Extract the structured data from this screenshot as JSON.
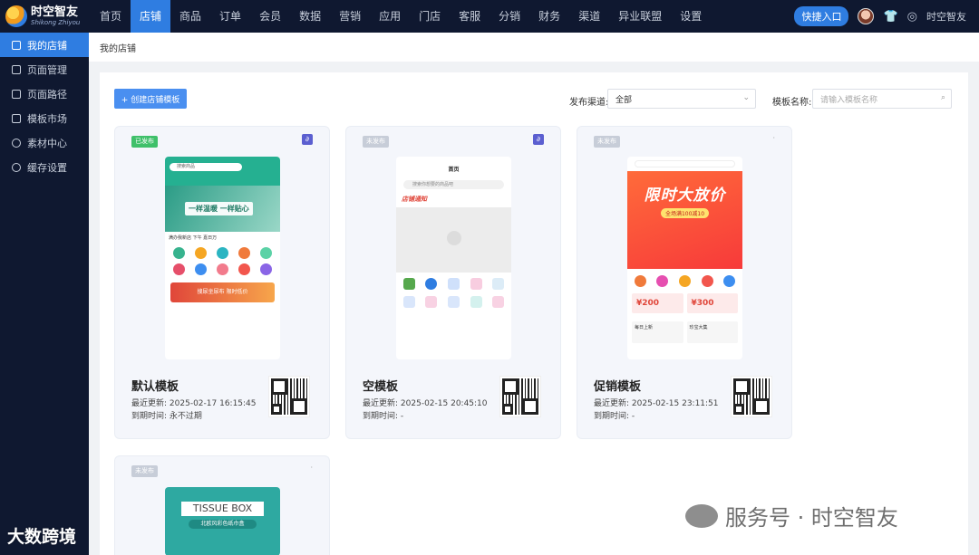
{
  "app": {
    "logo_cn": "时空智友",
    "logo_en": "Shikong Zhiyou"
  },
  "nav": [
    {
      "label": "首页"
    },
    {
      "label": "店铺",
      "active": true
    },
    {
      "label": "商品"
    },
    {
      "label": "订单"
    },
    {
      "label": "会员"
    },
    {
      "label": "数据"
    },
    {
      "label": "营销"
    },
    {
      "label": "应用"
    },
    {
      "label": "门店"
    },
    {
      "label": "客服"
    },
    {
      "label": "分销"
    },
    {
      "label": "财务"
    },
    {
      "label": "渠道"
    },
    {
      "label": "异业联盟"
    },
    {
      "label": "设置"
    }
  ],
  "top_right": {
    "quick_entry": "快捷入口",
    "user": "时空智友",
    "icons": [
      "avatar",
      "shirt-icon",
      "user-circle-icon"
    ]
  },
  "sidebar": [
    {
      "label": "我的店铺",
      "icon": "store-icon",
      "active": true
    },
    {
      "label": "页面管理",
      "icon": "page-icon"
    },
    {
      "label": "页面路径",
      "icon": "path-icon"
    },
    {
      "label": "模板市场",
      "icon": "template-market-icon"
    },
    {
      "label": "素材中心",
      "icon": "material-icon"
    },
    {
      "label": "缓存设置",
      "icon": "gear-icon"
    }
  ],
  "breadcrumb": "我的店铺",
  "toolbar": {
    "create_button": "+ 创建店铺模板",
    "channel_label": "发布渠道:",
    "channel_value": "全部",
    "name_label": "模板名称:",
    "name_placeholder": "请输入模板名称"
  },
  "labels": {
    "updated": "最近更新:",
    "expires": "到期时间:"
  },
  "cards": [
    {
      "status": "已发布",
      "title": "默认模板",
      "updated": "2025-02-17 16:15:45",
      "expires": "永不过期",
      "preview": {
        "search": "搜索商品",
        "banner": "一样温暖 一样贴心",
        "notice": "满办我新店 下午 嘉日万",
        "footer": "搜尿坐尿布 限时低价"
      }
    },
    {
      "status": "未发布",
      "title": "空模板",
      "updated": "2025-02-15 20:45:10",
      "expires": "-",
      "preview": {
        "page_title": "首页",
        "search": "搜索你想要的商品吧",
        "brand": "店铺通知"
      }
    },
    {
      "status": "未发布",
      "title": "促销模板",
      "updated": "2025-02-15 23:11:51",
      "expires": "-",
      "preview": {
        "banner_title": "限时大放价",
        "banner_sub": "全场满100减10",
        "coupon_1": "¥200",
        "coupon_2": "¥300",
        "box_1": "每日上新",
        "box_2": "珍宝大集"
      }
    },
    {
      "status": "未发布",
      "preview": {
        "title": "TISSUE BOX",
        "sub": "北欧风彩色纸巾盒"
      }
    }
  ],
  "watermarks": {
    "left": "大数跨境",
    "right": "服务号 · 时空智友"
  },
  "colors": {
    "accent": "#2f7de1",
    "nav_bg": "#0f1830",
    "published": "#3fc06a",
    "unpublished": "#c7cdd8"
  }
}
